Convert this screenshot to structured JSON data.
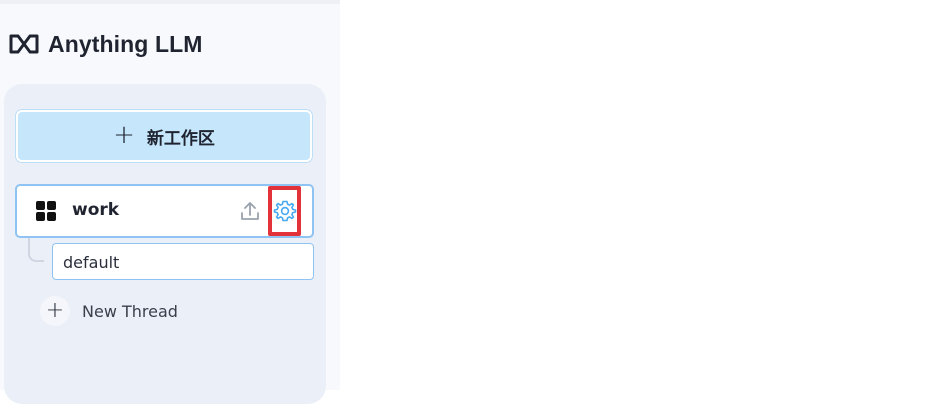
{
  "app": {
    "name": "Anything LLM"
  },
  "sidebar": {
    "new_workspace_label": "新工作区",
    "workspaces": [
      {
        "name": "work",
        "threads": [
          {
            "label": "default"
          }
        ],
        "new_thread_label": "New Thread"
      }
    ]
  },
  "icons": {
    "logo": "anything-llm-logo",
    "new_workspace": "plus-icon",
    "workspace": "grid-icon",
    "upload": "upload-icon",
    "settings": "gear-icon",
    "new_thread": "plus-icon"
  },
  "colors": {
    "accent": "#8fc3f4",
    "new_workspace_bg": "#c6e6fc",
    "gear": "#47a9f0",
    "highlight_box": "#e4323a"
  }
}
